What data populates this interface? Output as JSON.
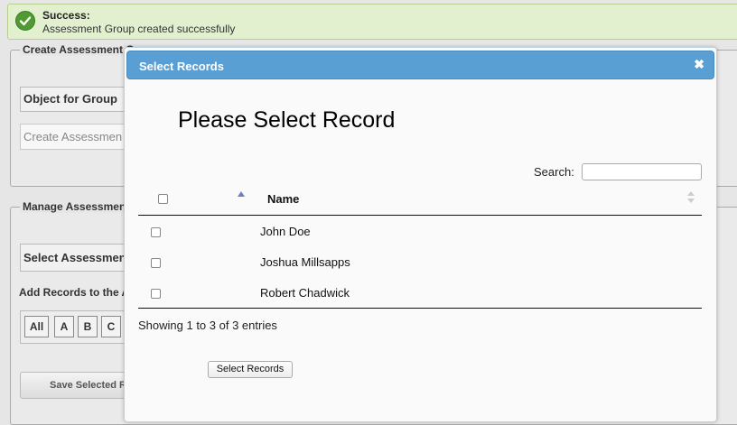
{
  "alert": {
    "title": "Success:",
    "message": "Assessment Group created successfully"
  },
  "background": {
    "create_panel": {
      "legend": "Create Assessment G",
      "object_label": "Object for Group",
      "create_placeholder": "Create Assessmen"
    },
    "manage_panel": {
      "legend": "Manage Assessment",
      "select_label": "Select Assessment",
      "add_records_label": "Add Records to the A",
      "alpha_buttons": [
        "All",
        "A",
        "B",
        "C"
      ],
      "save_label": "Save Selected R"
    }
  },
  "modal": {
    "title": "Select Records",
    "close_icon": "close-icon",
    "heading": "Please Select Record",
    "search_label": "Search:",
    "search_value": "",
    "columns": [
      "Name"
    ],
    "rows": [
      {
        "name": "John Doe",
        "checked": false
      },
      {
        "name": "Joshua Millsapps",
        "checked": false
      },
      {
        "name": "Robert Chadwick",
        "checked": false
      }
    ],
    "info": "Showing 1 to 3 of 3 entries",
    "select_button": "Select Records"
  },
  "colors": {
    "header_blue": "#5a9fd4",
    "success_bg": "#e3f0cf",
    "success_icon": "#4f9a33"
  }
}
